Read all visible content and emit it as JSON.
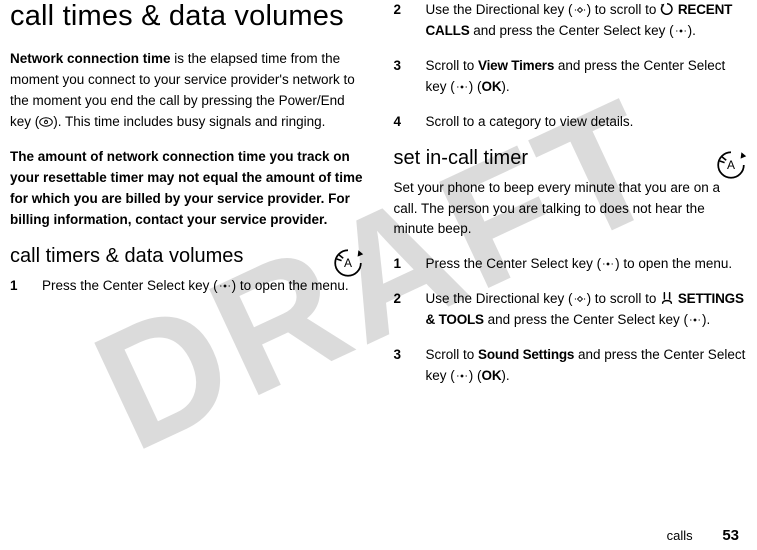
{
  "watermark": "DRAFT",
  "left": {
    "heading": "call times & data volumes",
    "para1_lead": "Network connection time",
    "para1_rest": " is the elapsed time from the moment you connect to your service provider's network to the moment you end the call by pressing the Power/End key (",
    "para1_tail": "). This time includes busy signals and ringing.",
    "para2": "The amount of network connection time you track on your resettable timer may not equal the amount of time for which you are billed by your service provider. For billing information, contact your service provider.",
    "sub1": "call timers & data volumes",
    "step1_num": "1",
    "step1_a": "Press the Center Select key (",
    "step1_b": ") to open the menu."
  },
  "right": {
    "step2_num": "2",
    "step2_a": "Use the Directional key (",
    "step2_b": ") to scroll to ",
    "step2_menu": "RECENT CALLS",
    "step2_c": " and press the Center Select key (",
    "step2_d": ").",
    "step3_num": "3",
    "step3_a": "Scroll to ",
    "step3_menu": "View Timers",
    "step3_b": " and press the Center Select key (",
    "step3_ok": "OK",
    "step3_c": ").",
    "step4_num": "4",
    "step4_a": "Scroll to a category to view details.",
    "sub2": "set in-call timer",
    "para3": "Set your phone to beep every minute that you are on a call. The person you are talking to does not hear the minute beep.",
    "b_step1_num": "1",
    "b_step1_a": "Press the Center Select key (",
    "b_step1_b": ") to open the menu.",
    "b_step2_num": "2",
    "b_step2_a": "Use the Directional key (",
    "b_step2_b": ") to scroll to ",
    "b_step2_menu": "SETTINGS & TOOLS",
    "b_step2_c": " and press the Center Select key (",
    "b_step2_d": ").",
    "b_step3_num": "3",
    "b_step3_a": "Scroll to ",
    "b_step3_menu": "Sound Settings",
    "b_step3_b": " and press the Center Select key (",
    "b_step3_ok": "OK",
    "b_step3_c": ")."
  },
  "footer": {
    "label": "calls",
    "page": "53"
  }
}
